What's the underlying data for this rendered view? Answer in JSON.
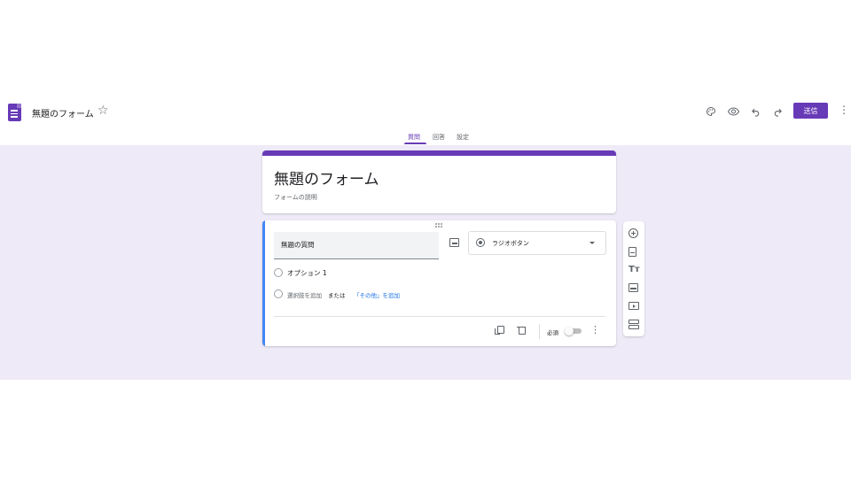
{
  "header": {
    "form_title": "無題のフォーム",
    "send_label": "送信",
    "icons": [
      "palette-icon",
      "eye-icon",
      "undo-icon",
      "redo-icon",
      "more-vert-icon"
    ]
  },
  "tabs": [
    {
      "label": "質問",
      "active": true
    },
    {
      "label": "回答",
      "active": false
    },
    {
      "label": "設定",
      "active": false
    }
  ],
  "title_card": {
    "title": "無題のフォーム",
    "description_placeholder": "フォームの説明"
  },
  "question": {
    "title": "無題の質問",
    "type": "ラジオボタン",
    "option_1": "オプション 1",
    "add_option": "選択肢を追加",
    "or": "または",
    "add_other": "「その他」を追加",
    "required_label": "必須",
    "required": false
  },
  "colors": {
    "accent": "#673ab7",
    "canvas": "#efeaf7",
    "focus_bar": "#4285f4",
    "link": "#1a73e8"
  }
}
